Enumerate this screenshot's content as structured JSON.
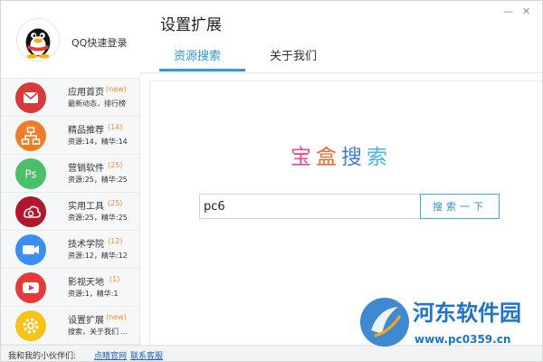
{
  "profile": {
    "name": "QQ快速登录"
  },
  "nav": [
    {
      "title": "应用首页",
      "count": "(new)",
      "sub": "最新动态，排行榜",
      "icon": "mail-icon",
      "color": "#d8393a"
    },
    {
      "title": "精品推荐",
      "count": "(14)",
      "sub": "资源:14，精华:14",
      "icon": "org-chart-icon",
      "color": "#ef7e2a"
    },
    {
      "title": "营销软件",
      "count": "(25)",
      "sub": "资源:25，精华:25",
      "icon": "ps-icon",
      "color": "#4cbf6a"
    },
    {
      "title": "实用工具",
      "count": "(25)",
      "sub": "资源:25，精华:25",
      "icon": "creative-cloud-icon",
      "color": "#b3172e"
    },
    {
      "title": "技术学院",
      "count": "(12)",
      "sub": "资源:12，精华:12",
      "icon": "video-camera-icon",
      "color": "#3b8ef2"
    },
    {
      "title": "影视天地",
      "count": "(1)",
      "sub": "资源:1，精华:1",
      "icon": "play-icon",
      "color": "#e63a3a"
    },
    {
      "title": "设置扩展",
      "count": "(new)",
      "sub": "搜索，关于我们 ...",
      "icon": "gear-icon",
      "color": "#f7c21a"
    }
  ],
  "footer": {
    "label": "我和我的小伙伴们:",
    "link1": "点睛官网",
    "link2": "联系客服"
  },
  "header": {
    "title": "设置扩展",
    "tabs": [
      "资源搜索",
      "关于我们"
    ],
    "minimize": "—",
    "close": "✕"
  },
  "search": {
    "logo_chars": [
      "宝",
      "盒",
      "搜",
      "索"
    ],
    "logo_colors": [
      "#e84b8c",
      "#ef6a2e",
      "#3f7fd6",
      "#4ab6e6"
    ],
    "query": "pc6",
    "button_label": "搜索一下"
  },
  "watermark": {
    "name": "河东软件园",
    "url": "www.pc0359.cn"
  }
}
